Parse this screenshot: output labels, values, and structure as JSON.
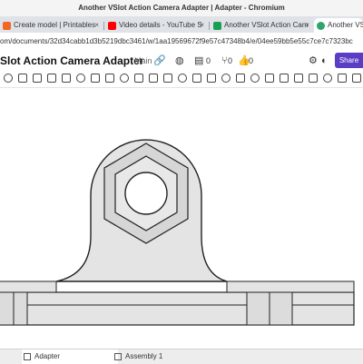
{
  "window": {
    "title": "Another VSlot Action Camera Adapter | Adapter - Chromium"
  },
  "tabs": [
    {
      "label": "Create model | Printables",
      "favicon_color": "#f26722"
    },
    {
      "label": "Video details - YouTube S",
      "favicon_color": "#ff0000"
    },
    {
      "label": "Another VSlot Action Cam",
      "favicon_color": "#1a9e55"
    },
    {
      "label": "Another VSlot",
      "favicon_color": "#2ea56b"
    }
  ],
  "address": {
    "url": "om/documents/32d34cabb1d3b5219dbc3461/w/1aa19569672f9e57c47348b4/e/04ee59bb5e55c7ce7c7323bc"
  },
  "document": {
    "title": "Slot Action Camera Adapter",
    "branch": "Main",
    "versions_count": "0",
    "branches_count": "0",
    "likes_count": "0",
    "share_label": "Share"
  },
  "bottom_tabs": [
    {
      "label": "Adapter",
      "active": true
    },
    {
      "label": "Assembly 1",
      "active": false
    }
  ],
  "colors": {
    "accent": "#5b3cc4",
    "part_fill": "#e4e4e4",
    "outline": "#222222"
  }
}
